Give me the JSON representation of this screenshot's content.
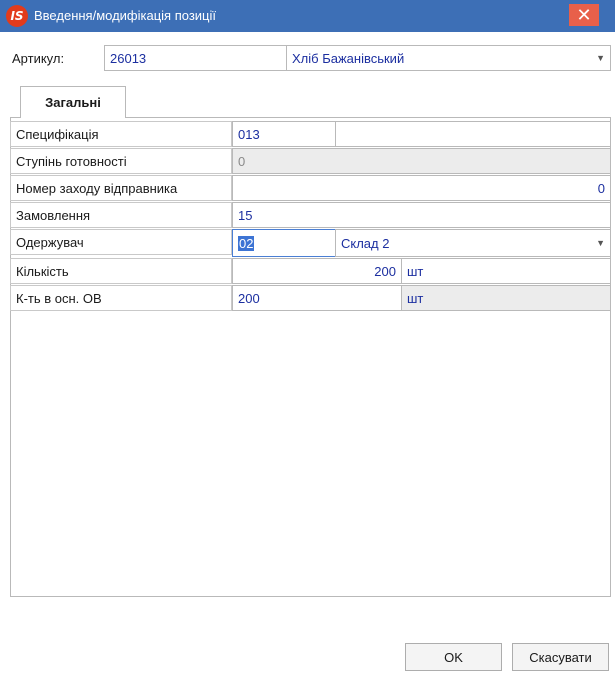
{
  "window": {
    "title": "Введення/модифікація позиції",
    "logo_text": "IS",
    "close_glyph": "✕"
  },
  "article": {
    "label": "Артикул:",
    "code": "26013",
    "name": "Хліб Бажанівський"
  },
  "tabs": [
    {
      "label": "Загальні",
      "active": true
    }
  ],
  "fields": {
    "specification": {
      "label": "Специфікація",
      "value": "013",
      "extra": ""
    },
    "readiness": {
      "label": "Ступінь готовності",
      "value": "0"
    },
    "sender_event": {
      "label": "Номер заходу відправника",
      "value": "0"
    },
    "order": {
      "label": "Замовлення",
      "value": "15"
    },
    "recipient": {
      "label": "Одержувач",
      "code": "02",
      "name": "Склад 2"
    },
    "quantity": {
      "label": "Кількість",
      "value": "200",
      "unit": "шт"
    },
    "qty_base": {
      "label": "К-ть в осн. ОВ",
      "value": "200",
      "unit": "шт"
    }
  },
  "buttons": {
    "ok": "OK",
    "cancel": "Скасувати"
  },
  "icons": {
    "dropdown": "chevron-down-icon",
    "logo": "is-logo-icon",
    "close": "close-icon"
  }
}
